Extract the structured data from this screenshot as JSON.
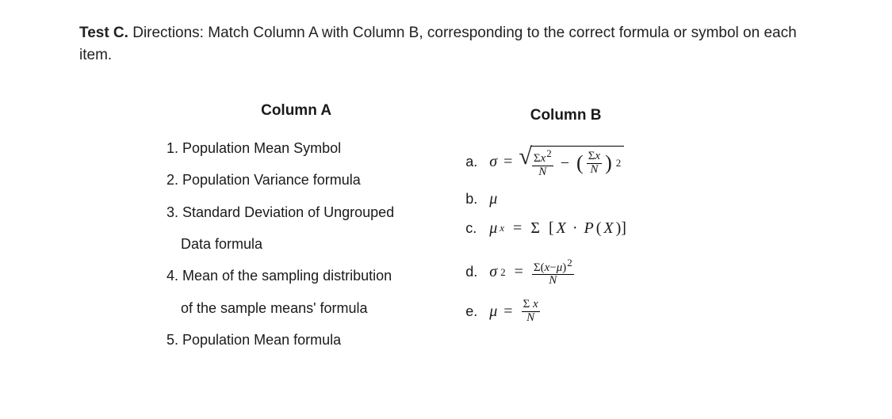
{
  "directions_prefix": "Test C.",
  "directions_text": " Directions: Match Column A with Column B, corresponding to the correct formula or symbol on each item.",
  "columnA": {
    "header": "Column A",
    "items": [
      "1. Population Mean Symbol",
      "2. Population Variance formula",
      "3. Standard Deviation of Ungrouped",
      "Data formula",
      "4. Mean of the sampling distribution",
      "of the sample means' formula",
      "5. Population Mean formula"
    ]
  },
  "columnB": {
    "header": "Column B",
    "items": [
      {
        "letter": "a.",
        "formula_id": "sigma_sqrt"
      },
      {
        "letter": "b.",
        "formula_id": "mu_symbol"
      },
      {
        "letter": "c.",
        "formula_id": "mu_x_sum"
      },
      {
        "letter": "d.",
        "formula_id": "sigma_sq"
      },
      {
        "letter": "e.",
        "formula_id": "mu_sumx"
      }
    ],
    "formulas": {
      "sigma_sqrt": "σ = √( Σx²/N − (Σx/N)² )",
      "mu_symbol": "μ",
      "mu_x_sum": "μₓ = Σ [X · P(X)]",
      "sigma_sq": "σ² = Σ(x−μ)² / N",
      "mu_sumx": "μ = Σx / N"
    }
  }
}
